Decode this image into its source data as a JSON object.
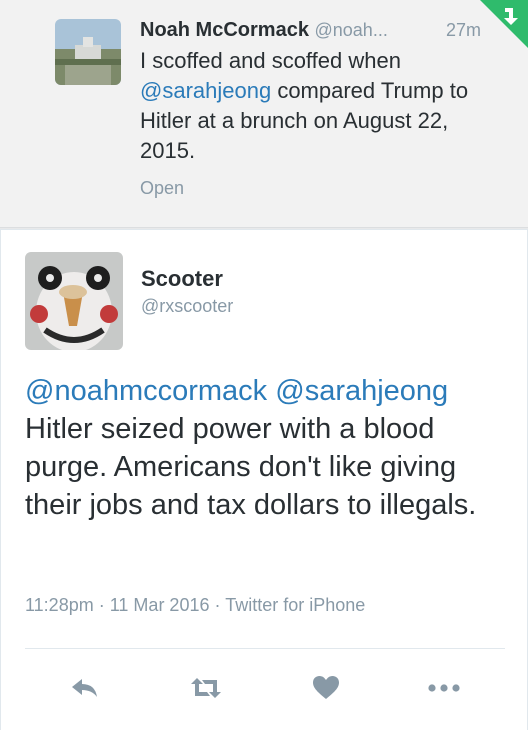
{
  "parent_tweet": {
    "name": "Noah McCormack",
    "handle": "@noah...",
    "time": "27m",
    "text_line1": "I scoffed and scoffed when",
    "mention": "@sarahjeong",
    "text_rest1": " compared Trump to",
    "text_rest2": "Hitler at a brunch on August 22,",
    "text_rest3": "2015.",
    "open_label": "Open"
  },
  "tweet": {
    "name": "Scooter",
    "handle": "@rxscooter",
    "mention1": "@noahmccormack",
    "mention2": "@sarahjeong",
    "body": "Hitler seized power with a blood purge. Americans don't like giving their jobs and tax dollars to illegals.",
    "time": "11:28pm",
    "date": "11 Mar 2016",
    "source": "Twitter for iPhone",
    "separator": "·"
  },
  "actions": {
    "reply_icon": "reply-icon",
    "retweet_icon": "retweet-icon",
    "like_icon": "heart-icon",
    "more_icon": "more-icon"
  },
  "colors": {
    "link": "#2b7bb9",
    "muted": "#8899a6",
    "text": "#292f33",
    "corner_badge": "#2fbb6c"
  }
}
